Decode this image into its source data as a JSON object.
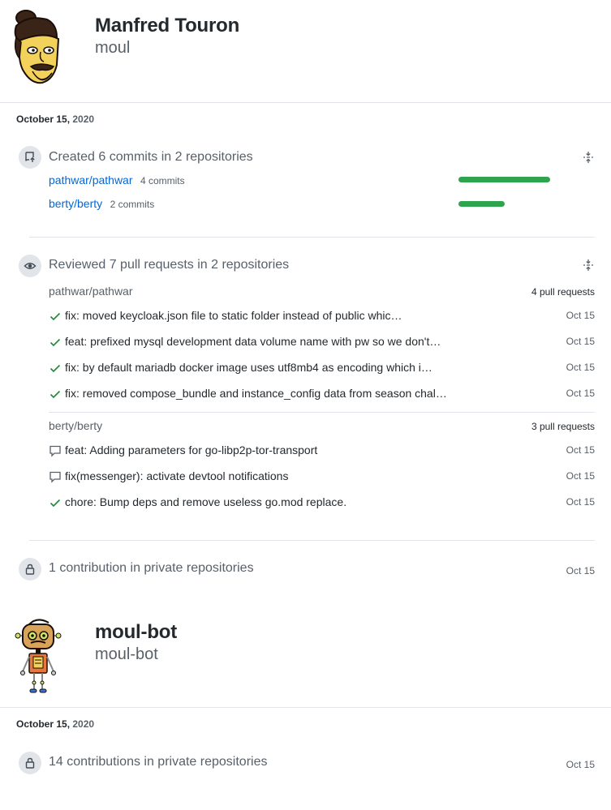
{
  "user1": {
    "name": "Manfred Touron",
    "login": "moul",
    "date": {
      "day": "October 15,",
      "year": "2020"
    },
    "commits": {
      "summary": "Created 6 commits in 2 repositories",
      "repos": [
        {
          "name": "pathwar/pathwar",
          "count": "4 commits",
          "share": 1.0
        },
        {
          "name": "berty/berty",
          "count": "2 commits",
          "share": 0.5
        }
      ]
    },
    "reviews": {
      "summary": "Reviewed 7 pull requests in 2 repositories",
      "groups": [
        {
          "repo": "pathwar/pathwar",
          "count": "4 pull requests",
          "items": [
            {
              "icon": "check-icon",
              "title": "fix: moved keycloak.json file to static folder instead of public whic…",
              "date": "Oct 15"
            },
            {
              "icon": "check-icon",
              "title": "feat: prefixed mysql development data volume name with pw so we don't…",
              "date": "Oct 15"
            },
            {
              "icon": "check-icon",
              "title": "fix: by default mariadb docker image uses utf8mb4 as encoding which i…",
              "date": "Oct 15"
            },
            {
              "icon": "check-icon",
              "title": "fix: removed compose_bundle and instance_config data from season chal…",
              "date": "Oct 15"
            }
          ]
        },
        {
          "repo": "berty/berty",
          "count": "3 pull requests",
          "items": [
            {
              "icon": "comment-icon",
              "title": "feat: Adding parameters for go-libp2p-tor-transport",
              "date": "Oct 15"
            },
            {
              "icon": "comment-icon",
              "title": "fix(messenger): activate devtool notifications",
              "date": "Oct 15"
            },
            {
              "icon": "check-icon",
              "title": "chore: Bump deps and remove useless go.mod replace.",
              "date": "Oct 15"
            }
          ]
        }
      ]
    },
    "private": {
      "summary": "1 contribution in private repositories",
      "date": "Oct 15"
    }
  },
  "user2": {
    "name": "moul-bot",
    "login": "moul-bot",
    "date": {
      "day": "October 15,",
      "year": "2020"
    },
    "private": {
      "summary": "14 contributions in private repositories",
      "date": "Oct 15"
    }
  },
  "colors": {
    "link": "#0366d6",
    "bar": "#2ea44f",
    "check": "#22863a",
    "muted": "#586069",
    "divider": "#e1e4e8"
  }
}
